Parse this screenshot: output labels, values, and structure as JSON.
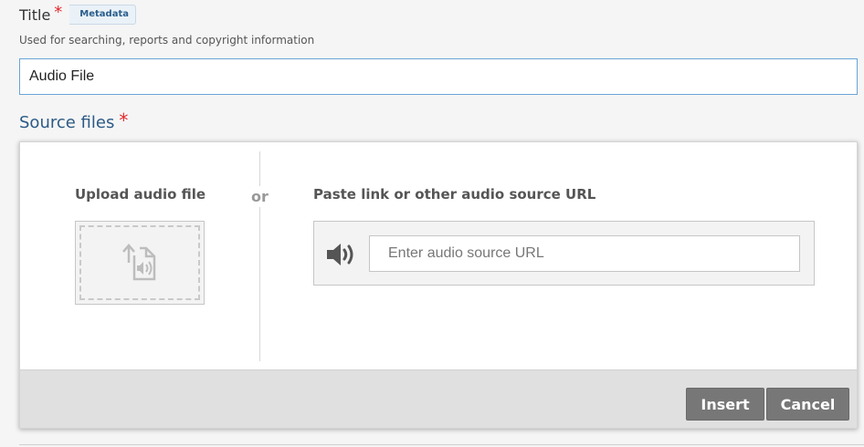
{
  "title_field": {
    "label": "Title",
    "required_mark": "*",
    "badge": "Metadata",
    "help": "Used for searching, reports and copyright information",
    "value": "Audio File"
  },
  "source": {
    "heading": "Source files",
    "required_mark": "*"
  },
  "upload": {
    "heading": "Upload audio file",
    "icon": "upload-audio-file-icon"
  },
  "or_label": "or",
  "url": {
    "heading": "Paste link or other audio source URL",
    "icon": "speaker-icon",
    "placeholder": "Enter audio source URL"
  },
  "buttons": {
    "insert": "Insert",
    "cancel": "Cancel"
  },
  "colors": {
    "heading_blue": "#2c5a85",
    "required_red": "#e4282e",
    "button_gray": "#777777",
    "input_focus_border": "#6aa3d6"
  }
}
